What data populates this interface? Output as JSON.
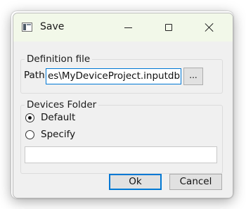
{
  "window": {
    "title": "Save"
  },
  "definition_group": {
    "legend": "Definition file",
    "path_label": "Path",
    "path_value": "es\\MyDeviceProject.inputdb",
    "browse_label": "..."
  },
  "devices_group": {
    "legend": "Devices Folder",
    "options": [
      {
        "label": "Default",
        "checked": true
      },
      {
        "label": "Specify",
        "checked": false
      }
    ],
    "folder_value": ""
  },
  "buttons": {
    "ok": "Ok",
    "cancel": "Cancel"
  }
}
